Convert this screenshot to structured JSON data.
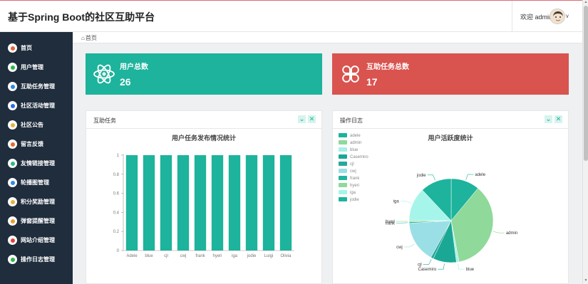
{
  "header": {
    "title": "基于Spring Boot的社区互助平台",
    "welcome": "欢迎 admin"
  },
  "breadcrumb": {
    "home": "首页"
  },
  "sidebar": {
    "items": [
      {
        "label": "首页",
        "icon": "home-icon",
        "color": "#e8643c"
      },
      {
        "label": "用户管理",
        "icon": "user-icon",
        "color": "#2db84c"
      },
      {
        "label": "互助任务管理",
        "icon": "task-icon",
        "color": "#2c8be8"
      },
      {
        "label": "社区活动管理",
        "icon": "drop-icon",
        "color": "#2c6be8"
      },
      {
        "label": "社区公告",
        "icon": "notice-icon",
        "color": "#e8b23c"
      },
      {
        "label": "留言反馈",
        "icon": "message-icon",
        "color": "#e86a2c"
      },
      {
        "label": "友情链接管理",
        "icon": "link-icon",
        "color": "#2db884"
      },
      {
        "label": "轮播图管理",
        "icon": "carousel-icon",
        "color": "#2c8be8"
      },
      {
        "label": "积分奖励管理",
        "icon": "points-icon",
        "color": "#e8b23c"
      },
      {
        "label": "弹窗提醒管理",
        "icon": "popup-icon",
        "color": "#e8a02c"
      },
      {
        "label": "网站介绍管理",
        "icon": "site-icon",
        "color": "#e8403c"
      },
      {
        "label": "操作日志管理",
        "icon": "log-icon",
        "color": "#2db84c"
      }
    ]
  },
  "stats": {
    "users": {
      "label": "用户总数",
      "value": "26",
      "icon": "atom-icon",
      "color": "#1db39c"
    },
    "tasks": {
      "label": "互助任务总数",
      "value": "17",
      "icon": "clover-icon",
      "color": "#d9534f"
    }
  },
  "panels": {
    "left": {
      "title": "互助任务"
    },
    "right": {
      "title": "操作日志"
    }
  },
  "chart_data": [
    {
      "type": "bar",
      "title": "用户任务发布情况统计",
      "categories": [
        "Adele",
        "blue",
        "cjl",
        "cwj",
        "frank",
        "hyeri",
        "iga",
        "jodie",
        "Luigi",
        "Olivia"
      ],
      "values": [
        1,
        1,
        1,
        1,
        1,
        1,
        1,
        1,
        1,
        1
      ],
      "ylim": [
        0,
        1
      ],
      "yticks": [
        "0",
        "0.2",
        "0.4",
        "0.6",
        "0.8",
        "1"
      ],
      "color": "#1db39c"
    },
    {
      "type": "pie",
      "title": "用户活跃度统计",
      "legend": [
        "adele",
        "admin",
        "blue",
        "Casemiro",
        "cjl",
        "cwj",
        "frank",
        "hyeri",
        "iga",
        "jodie"
      ],
      "slices": [
        {
          "label": "adele",
          "value": 11,
          "color": "#1db39c"
        },
        {
          "label": "admin",
          "value": 36,
          "color": "#8fd99a"
        },
        {
          "label": "blue",
          "value": 1,
          "color": "#a6f0e8"
        },
        {
          "label": "Casemiro",
          "value": 9,
          "color": "#1aa895"
        },
        {
          "label": "cjl",
          "value": 1,
          "color": "#26a89a"
        },
        {
          "label": "cwj",
          "value": 16,
          "color": "#9adfe6"
        },
        {
          "label": "frank",
          "value": 0.5,
          "color": "#20b39e"
        },
        {
          "label": "hyeri",
          "value": 0.5,
          "color": "#8fd99a"
        },
        {
          "label": "iga",
          "value": 13,
          "color": "#a6f5ea"
        },
        {
          "label": "jodie",
          "value": 12,
          "color": "#1db39c"
        }
      ]
    }
  ]
}
